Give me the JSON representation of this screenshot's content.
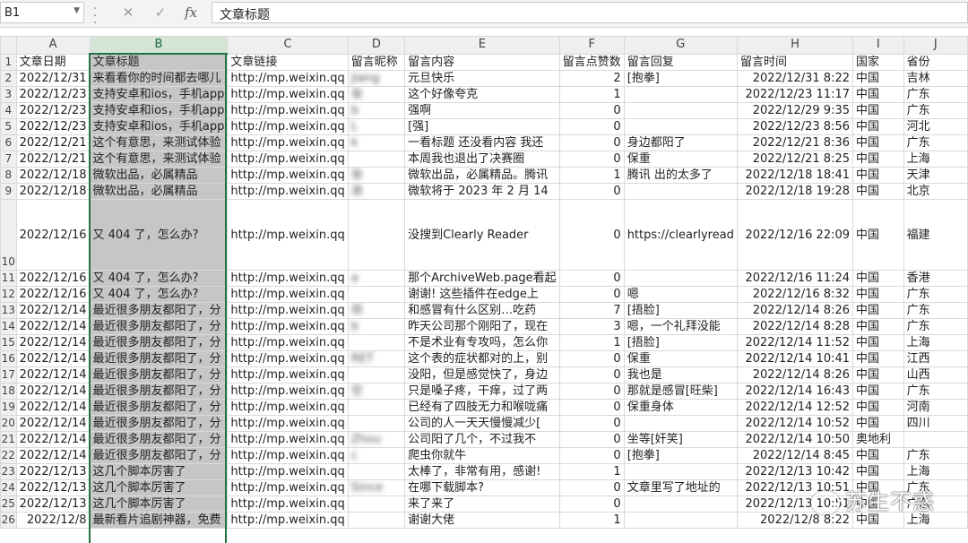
{
  "formula_bar": {
    "name_box": "B1",
    "cancel_icon": "✕",
    "enter_icon": "✓",
    "fx_label": "fx",
    "content": "文章标题"
  },
  "columns": [
    "A",
    "B",
    "C",
    "D",
    "E",
    "F",
    "G",
    "H",
    "I",
    "J"
  ],
  "selected_column": "B",
  "header_row": {
    "row_number": "1",
    "cells": [
      "文章日期",
      "文章标题",
      "文章链接",
      "留言昵称",
      "留言内容",
      "留言点赞数",
      "留言回复",
      "留言时间",
      "国家",
      "省份"
    ]
  },
  "rows": [
    {
      "n": "2",
      "cells": [
        "2022/12/31",
        "来看看你的时间都去哪儿",
        "http://mp.weixin.qq",
        "jiang",
        "元旦快乐",
        "2",
        "[抱拳]",
        "2022/12/31 8:22",
        "中国",
        "吉林"
      ]
    },
    {
      "n": "3",
      "cells": [
        "2022/12/23",
        "支持安卓和ios，手机app",
        "http://mp.weixin.qq",
        "张",
        "这个好像夸克",
        "1",
        "",
        "2022/12/23 11:17",
        "中国",
        "广东"
      ]
    },
    {
      "n": "4",
      "cells": [
        "2022/12/23",
        "支持安卓和ios，手机app",
        "http://mp.weixin.qq",
        "b",
        "强啊",
        "0",
        "",
        "2022/12/29 9:35",
        "中国",
        "广东"
      ]
    },
    {
      "n": "5",
      "cells": [
        "2022/12/23",
        "支持安卓和ios，手机app",
        "http://mp.weixin.qq",
        "L",
        "[强]",
        "0",
        "",
        "2022/12/23 8:56",
        "中国",
        "河北"
      ]
    },
    {
      "n": "6",
      "cells": [
        "2022/12/21",
        "这个有意思，来测试体验",
        "http://mp.weixin.qq",
        "k",
        "一看标题 还没看内容 我还",
        "0",
        "身边都阳了",
        "2022/12/21 8:36",
        "中国",
        "广东"
      ]
    },
    {
      "n": "7",
      "cells": [
        "2022/12/21",
        "这个有意思，来测试体验",
        "http://mp.weixin.qq",
        "",
        "本周我也退出了决赛圈",
        "0",
        "保重",
        "2022/12/21 8:25",
        "中国",
        "上海"
      ]
    },
    {
      "n": "8",
      "cells": [
        "2022/12/18",
        "微软出品，必属精品",
        "http://mp.weixin.qq",
        "张",
        "微软出品，必属精品。腾讯",
        "1",
        "腾讯  出的太多了",
        "2022/12/18 18:41",
        "中国",
        "天津"
      ]
    },
    {
      "n": "9",
      "cells": [
        "2022/12/18",
        "微软出品，必属精品",
        "http://mp.weixin.qq",
        "浪",
        "微软将于 2023 年 2 月 14",
        "0",
        "",
        "2022/12/18 19:28",
        "中国",
        "北京"
      ]
    },
    {
      "n": "10",
      "cells": [
        "2022/12/16",
        "又 404 了，怎么办?",
        "http://mp.weixin.qq",
        "",
        "没搜到Clearly Reader",
        "0",
        "https://clearlyread",
        "2022/12/16 22:09",
        "中国",
        "福建"
      ]
    },
    {
      "n": "11",
      "cells": [
        "2022/12/16",
        "又 404 了，怎么办?",
        "http://mp.weixin.qq",
        "a",
        "那个ArchiveWeb.page看起",
        "0",
        "",
        "2022/12/16 11:24",
        "中国",
        "香港"
      ]
    },
    {
      "n": "12",
      "cells": [
        "2022/12/16",
        "又 404 了，怎么办?",
        "http://mp.weixin.qq",
        "",
        "谢谢! 这些插件在edge上",
        "0",
        "嗯",
        "2022/12/16 8:32",
        "中国",
        "广东"
      ]
    },
    {
      "n": "13",
      "cells": [
        "2022/12/14",
        "最近很多朋友都阳了，分",
        "http://mp.weixin.qq",
        "坝",
        "和感冒有什么区别…吃药",
        "7",
        "[捂脸]",
        "2022/12/14 8:26",
        "中国",
        "广东"
      ]
    },
    {
      "n": "14",
      "cells": [
        "2022/12/14",
        "最近很多朋友都阳了，分",
        "http://mp.weixin.qq",
        "b",
        "昨天公司那个刚阳了，现在",
        "3",
        "嗯，一个礼拜没能",
        "2022/12/14 8:28",
        "中国",
        "广东"
      ]
    },
    {
      "n": "15",
      "cells": [
        "2022/12/14",
        "最近很多朋友都阳了，分",
        "http://mp.weixin.qq",
        "",
        "不是术业有专攻吗，怎么你",
        "1",
        "[捂脸]",
        "2022/12/14 11:52",
        "中国",
        "上海"
      ]
    },
    {
      "n": "16",
      "cells": [
        "2022/12/14",
        "最近很多朋友都阳了，分",
        "http://mp.weixin.qq",
        "RET",
        "这个表的症状都对的上，别",
        "0",
        "保重",
        "2022/12/14 10:41",
        "中国",
        "江西"
      ]
    },
    {
      "n": "17",
      "cells": [
        "2022/12/14",
        "最近很多朋友都阳了，分",
        "http://mp.weixin.qq",
        "",
        "没阳，但是感觉快了，身边",
        "0",
        "我也是",
        "2022/12/14 8:26",
        "中国",
        "山西"
      ]
    },
    {
      "n": "18",
      "cells": [
        "2022/12/14",
        "最近很多朋友都阳了，分",
        "http://mp.weixin.qq",
        "空",
        "只是嗓子疼，干痒，过了两",
        "0",
        "那就是感冒[旺柴]",
        "2022/12/14 16:43",
        "中国",
        "广东"
      ]
    },
    {
      "n": "19",
      "cells": [
        "2022/12/14",
        "最近很多朋友都阳了，分",
        "http://mp.weixin.qq",
        "",
        "已经有了四肢无力和喉咙痛",
        "0",
        "保重身体",
        "2022/12/14 12:52",
        "中国",
        "河南"
      ]
    },
    {
      "n": "20",
      "cells": [
        "2022/12/14",
        "最近很多朋友都阳了，分",
        "http://mp.weixin.qq",
        "",
        "公司的人一天天慢慢减少[",
        "0",
        "",
        "2022/12/14 10:52",
        "中国",
        "四川"
      ]
    },
    {
      "n": "21",
      "cells": [
        "2022/12/14",
        "最近很多朋友都阳了，分",
        "http://mp.weixin.qq",
        "Zhou",
        "公司阳了几个，不过我不",
        "0",
        "坐等[奸笑]",
        "2022/12/14 10:50",
        "奥地利",
        ""
      ]
    },
    {
      "n": "22",
      "cells": [
        "2022/12/14",
        "最近很多朋友都阳了，分",
        "http://mp.weixin.qq",
        "c",
        "爬虫你就牛",
        "0",
        "[抱拳]",
        "2022/12/14 8:45",
        "中国",
        "广东"
      ]
    },
    {
      "n": "23",
      "cells": [
        "2022/12/13",
        "这几个脚本厉害了",
        "http://mp.weixin.qq",
        "",
        "太棒了，非常有用，感谢!",
        "1",
        "",
        "2022/12/13 10:42",
        "中国",
        "上海"
      ]
    },
    {
      "n": "24",
      "cells": [
        "2022/12/13",
        "这几个脚本厉害了",
        "http://mp.weixin.qq",
        "Since",
        "在哪下载脚本?",
        "0",
        "文章里写了地址的",
        "2022/12/13 10:51",
        "中国",
        "广东"
      ]
    },
    {
      "n": "25",
      "cells": [
        "2022/12/13",
        "这几个脚本厉害了",
        "http://mp.weixin.qq",
        "",
        "来了来了",
        "0",
        "",
        "2022/12/13 10:51",
        "中国",
        "广东"
      ]
    },
    {
      "n": "26",
      "cells": [
        "2022/12/8",
        "最新看片追剧神器，免费",
        "http://mp.weixin.qq",
        "",
        "谢谢大佬",
        "1",
        "",
        "2022/12/8 8:22",
        "中国",
        "上海"
      ]
    }
  ],
  "tall_row": "10",
  "watermark": "苏生不惑"
}
